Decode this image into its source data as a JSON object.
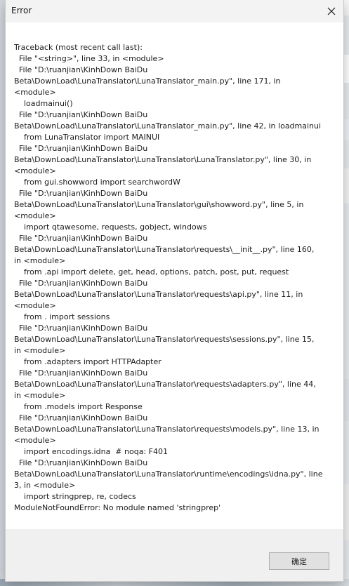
{
  "dialog": {
    "title": "Error",
    "close_icon": "close-icon",
    "message_lines": [
      "Traceback (most recent call last):",
      "  File \"<string>\", line 33, in <module>",
      "  File \"D:\\ruanjian\\KinhDown BaiDu Beta\\DownLoad\\LunaTranslator\\LunaTranslator_main.py\", line 171, in <module>",
      "    loadmainui()",
      "  File \"D:\\ruanjian\\KinhDown BaiDu Beta\\DownLoad\\LunaTranslator\\LunaTranslator_main.py\", line 42, in loadmainui",
      "    from LunaTranslator import MAINUI",
      "  File \"D:\\ruanjian\\KinhDown BaiDu Beta\\DownLoad\\LunaTranslator\\LunaTranslator\\LunaTranslator.py\", line 30, in <module>",
      "    from gui.showword import searchwordW",
      "  File \"D:\\ruanjian\\KinhDown BaiDu Beta\\DownLoad\\LunaTranslator\\LunaTranslator\\gui\\showword.py\", line 5, in <module>",
      "    import qtawesome, requests, gobject, windows",
      "  File \"D:\\ruanjian\\KinhDown BaiDu Beta\\DownLoad\\LunaTranslator\\LunaTranslator\\requests\\__init__.py\", line 160, in <module>",
      "    from .api import delete, get, head, options, patch, post, put, request",
      "  File \"D:\\ruanjian\\KinhDown BaiDu Beta\\DownLoad\\LunaTranslator\\LunaTranslator\\requests\\api.py\", line 11, in <module>",
      "    from . import sessions",
      "  File \"D:\\ruanjian\\KinhDown BaiDu Beta\\DownLoad\\LunaTranslator\\LunaTranslator\\requests\\sessions.py\", line 15, in <module>",
      "    from .adapters import HTTPAdapter",
      "  File \"D:\\ruanjian\\KinhDown BaiDu Beta\\DownLoad\\LunaTranslator\\LunaTranslator\\requests\\adapters.py\", line 44, in <module>",
      "    from .models import Response",
      "  File \"D:\\ruanjian\\KinhDown BaiDu Beta\\DownLoad\\LunaTranslator\\LunaTranslator\\requests\\models.py\", line 13, in <module>",
      "    import encodings.idna  # noqa: F401",
      "  File \"D:\\ruanjian\\KinhDown BaiDu Beta\\DownLoad\\LunaTranslator\\LunaTranslator\\runtime\\encodings\\idna.py\", line 3, in <module>",
      "    import stringprep, re, codecs",
      "ModuleNotFoundError: No module named 'stringprep'"
    ],
    "ok_label": "确定"
  }
}
